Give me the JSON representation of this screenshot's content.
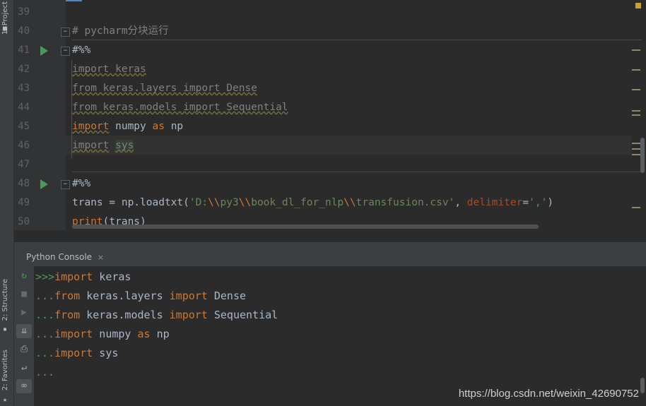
{
  "left_tabs": {
    "project": "1: Project",
    "structure": "2: Structure",
    "favorites": "2: Favorites"
  },
  "editor": {
    "lines": [
      {
        "n": "39"
      },
      {
        "n": "40",
        "text": "# pycharm分块运行"
      },
      {
        "n": "41",
        "text": "#%%"
      },
      {
        "n": "42",
        "text": "import keras"
      },
      {
        "n": "43",
        "text": "from keras.layers import Dense"
      },
      {
        "n": "44",
        "text": "from keras.models import Sequential"
      },
      {
        "n": "45",
        "kw1": "import",
        "text2": " numpy ",
        "kw2": "as",
        "text3": " np"
      },
      {
        "n": "46",
        "kw1": "import",
        "mod": "sys"
      },
      {
        "n": "47"
      },
      {
        "n": "48",
        "text": "#%%"
      },
      {
        "n": "49",
        "a": "trans = np.loadtxt(",
        "s1": "'D:",
        "e1": "\\\\",
        "s2": "py3",
        "e2": "\\\\",
        "s3": "book_dl_for_nlp",
        "e3": "\\\\",
        "s4": "transfusion.csv'",
        "comma": ", ",
        "param": "delimiter",
        "eq": "=",
        "s5": "','",
        "close": ")"
      },
      {
        "n": "50",
        "fn": "print",
        "rest": "(trans)"
      }
    ]
  },
  "console": {
    "tab_label": "Python Console",
    "tab_close": "×",
    "prompt_first": ">>>",
    "prompt_cont": "...",
    "lines": [
      {
        "kw1": "import",
        "t1": " keras"
      },
      {
        "kw1": "from",
        "t1": " keras.layers ",
        "kw2": "import",
        "t2": " Dense"
      },
      {
        "kw1": "from",
        "t1": " keras.models ",
        "kw2": "import",
        "t2": " Sequential"
      },
      {
        "kw1": "import",
        "t1": " numpy ",
        "kw2": "as",
        "t2": " np"
      },
      {
        "kw1": "import",
        "t1": " sys"
      }
    ]
  },
  "watermark": "https://blog.csdn.net/weixin_42690752",
  "colors": {
    "keyword": "#cc7832",
    "string": "#6a8759",
    "prompt": "#499c54",
    "text": "#a9b7c6",
    "linenum": "#606366",
    "background": "#2b2b2b",
    "panel": "#3c3f41"
  },
  "icons": [
    "rerun-icon",
    "stop-icon",
    "run-icon",
    "scroll-to-end-icon",
    "print-icon",
    "soft-wrap-icon",
    "infinity-icon",
    "folder-icon",
    "structure-icon",
    "star-icon"
  ]
}
